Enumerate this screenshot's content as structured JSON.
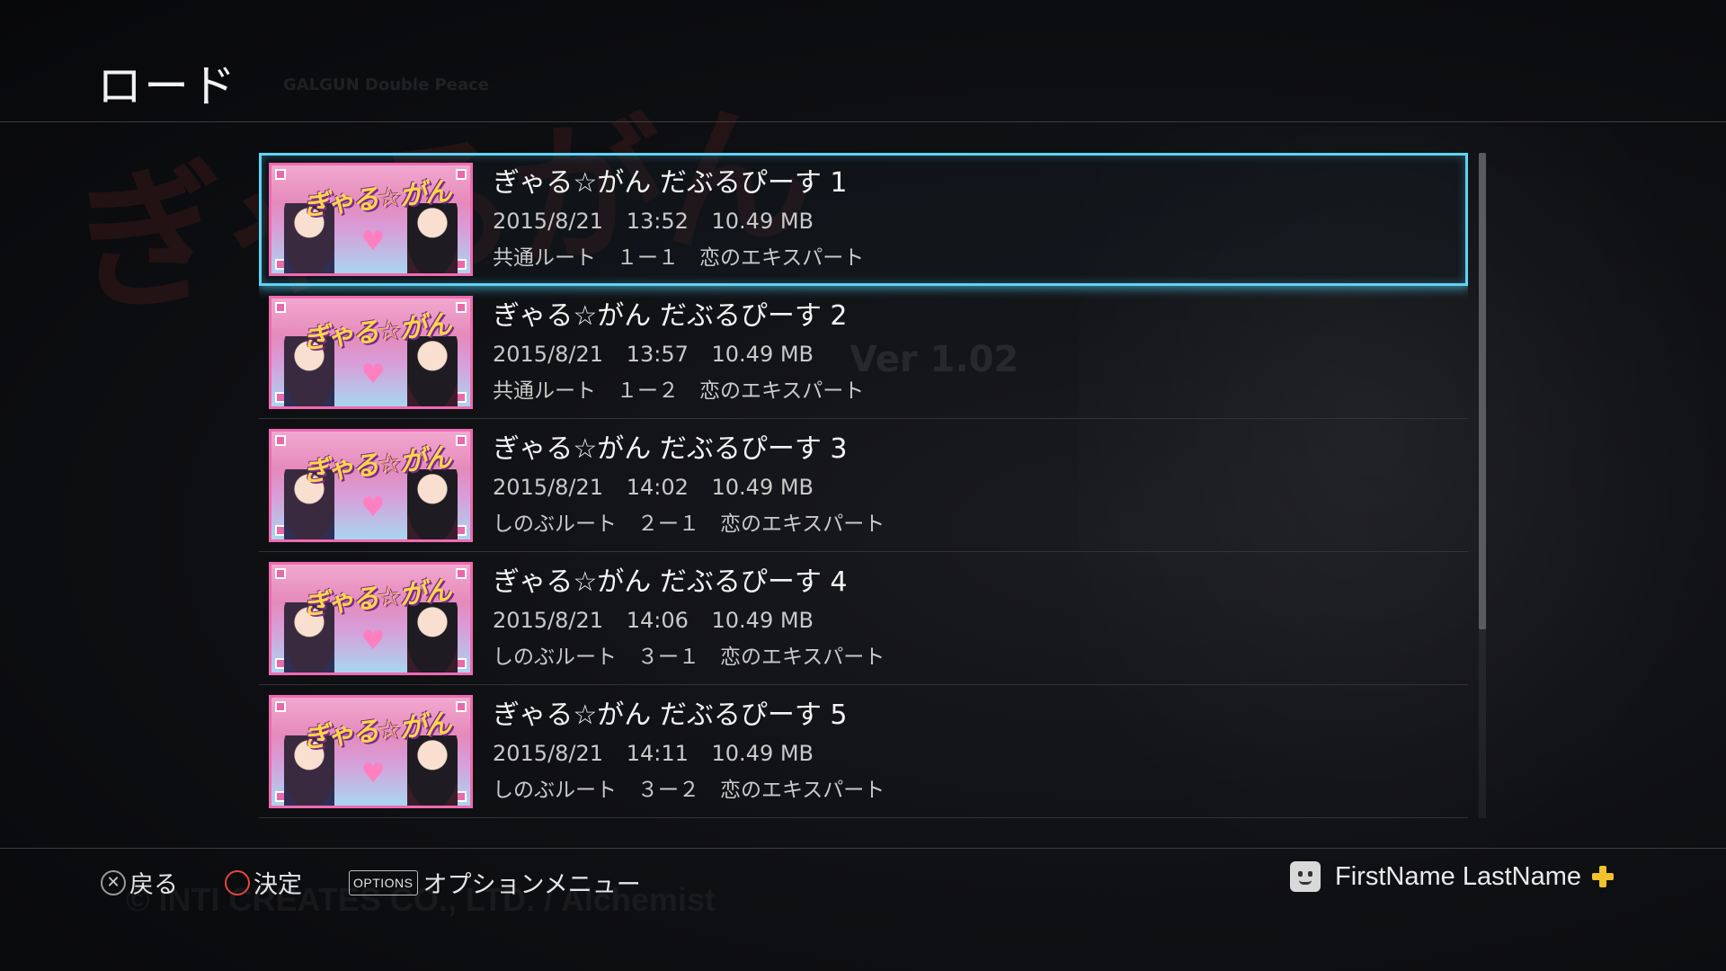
{
  "header": {
    "title": "ロード"
  },
  "background": {
    "logo": "ぎゃるがん",
    "caption": "GALGUN Double Peace",
    "version": "Ver 1.02",
    "copyright": "© INTI CREATES CO., LTD. / Alchemist"
  },
  "saves": [
    {
      "title": "ぎゃる☆がん だぶるぴーす 1",
      "date": "2015/8/21",
      "time": "13:52",
      "size": "10.49 MB",
      "detail": "共通ルート　１ー１　恋のエキスパート",
      "selected": true
    },
    {
      "title": "ぎゃる☆がん だぶるぴーす 2",
      "date": "2015/8/21",
      "time": "13:57",
      "size": "10.49 MB",
      "detail": "共通ルート　１ー２　恋のエキスパート",
      "selected": false
    },
    {
      "title": "ぎゃる☆がん だぶるぴーす 3",
      "date": "2015/8/21",
      "time": "14:02",
      "size": "10.49 MB",
      "detail": "しのぶルート　２ー１　恋のエキスパート",
      "selected": false
    },
    {
      "title": "ぎゃる☆がん だぶるぴーす 4",
      "date": "2015/8/21",
      "time": "14:06",
      "size": "10.49 MB",
      "detail": "しのぶルート　３ー１　恋のエキスパート",
      "selected": false
    },
    {
      "title": "ぎゃる☆がん だぶるぴーす 5",
      "date": "2015/8/21",
      "time": "14:11",
      "size": "10.49 MB",
      "detail": "しのぶルート　３ー２　恋のエキスパート",
      "selected": false
    }
  ],
  "thumbnail": {
    "logo_text": "ぎゃる☆がん"
  },
  "footer": {
    "back": {
      "icon": "cross-button-icon",
      "label": "戻る"
    },
    "confirm": {
      "icon": "circle-button-icon",
      "label": "決定"
    },
    "options": {
      "icon_label": "OPTIONS",
      "label": "オプションメニュー"
    },
    "user": {
      "name": "FirstName LastName",
      "avatar_icon": "avatar-icon",
      "plus_icon": "playstation-plus-icon"
    }
  },
  "colors": {
    "selection": "#5fd3f3",
    "circle_button": "#e2473f",
    "plus": "#f3c12c"
  }
}
